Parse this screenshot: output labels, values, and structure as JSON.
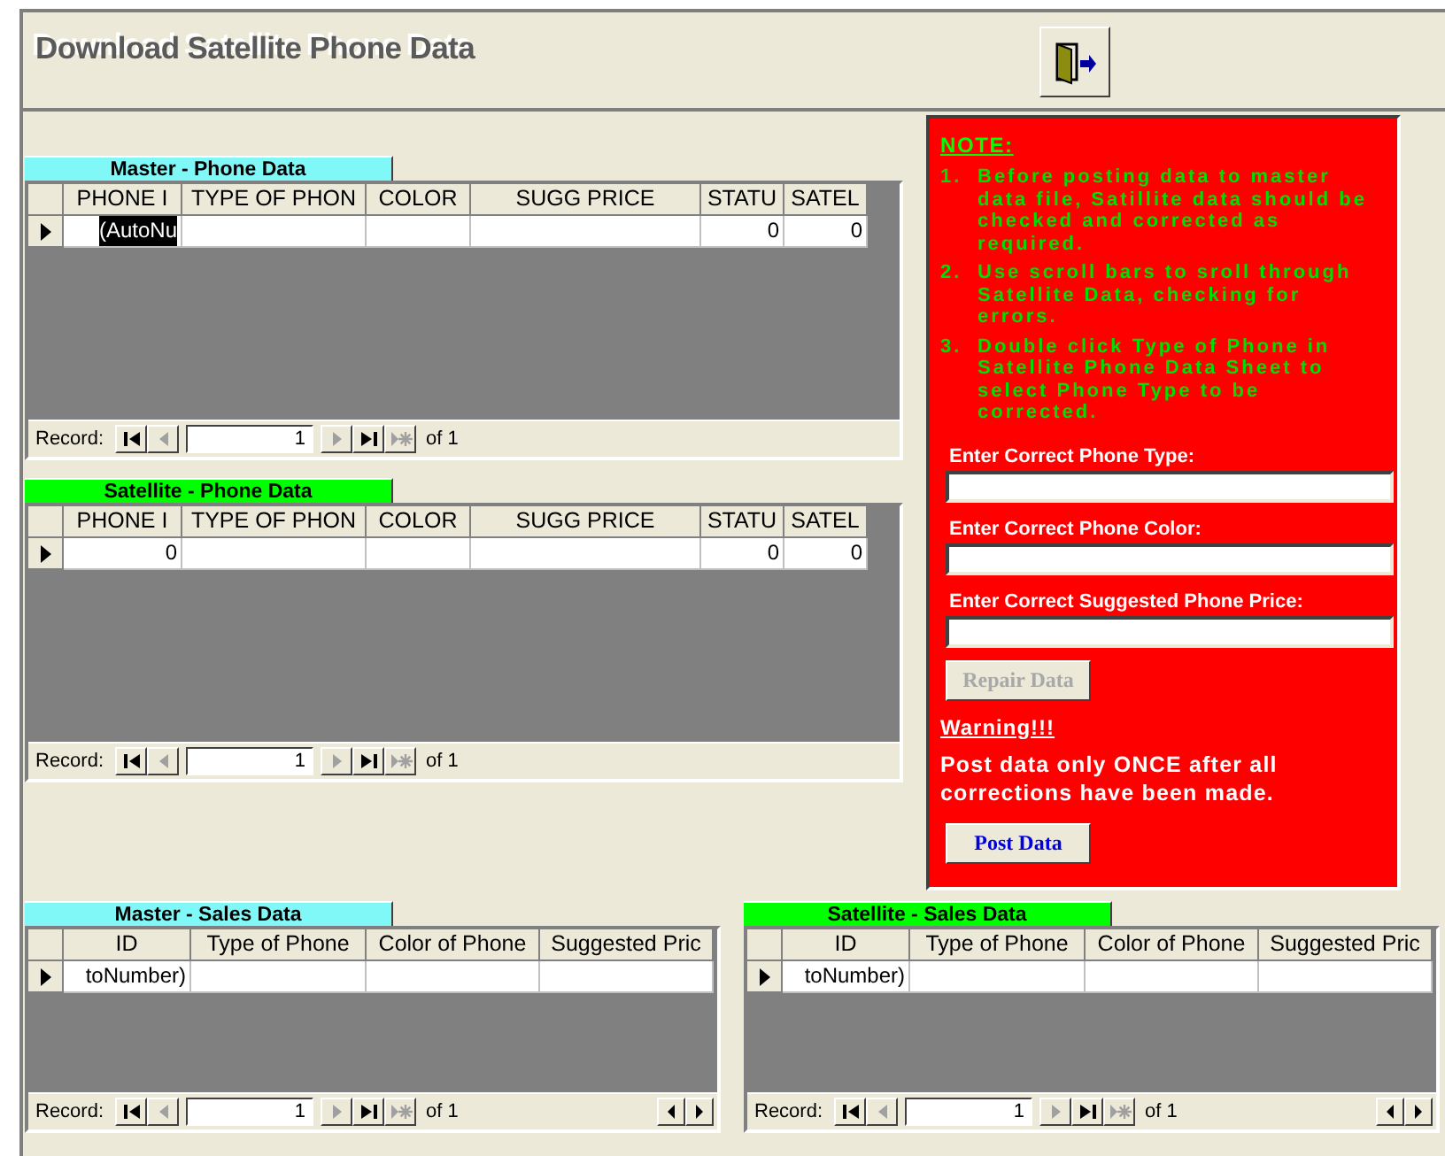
{
  "window": {
    "title": "Download Satellite Phone Data"
  },
  "phone_sheets": [
    {
      "caption": "Master - Phone  Data",
      "color": "#80f8f8",
      "kind": "phone",
      "columns": [
        "PHONE I",
        "TYPE OF PHON",
        "COLOR",
        "SUGG PRICE",
        "STATU",
        "SATEL"
      ],
      "rows": [
        {
          "current": true,
          "cells": [
            {
              "text": "(AutoNu",
              "selected": true
            },
            {
              "selected": false
            },
            {
              "selected": false
            },
            {
              "selected": false
            },
            {
              "text": "0",
              "selected": false
            },
            {
              "text": "0",
              "selected": false
            }
          ]
        }
      ],
      "navigator": {
        "label": "Record:",
        "value": "1",
        "total": "of 1",
        "buttons": [
          {
            "kind": "first",
            "disabled": false
          },
          {
            "kind": "prev",
            "disabled": true
          },
          {
            "kind": "next",
            "disabled": true
          },
          {
            "kind": "last",
            "disabled": false
          },
          {
            "kind": "new",
            "disabled": true
          }
        ]
      }
    },
    {
      "caption": "Satellite - Phone Data",
      "color": "#00ff00",
      "kind": "phone",
      "columns": [
        "PHONE I",
        "TYPE OF PHON",
        "COLOR",
        "SUGG PRICE",
        "STATU",
        "SATEL"
      ],
      "rows": [
        {
          "current": true,
          "cells": [
            {
              "text": "0",
              "selected": false
            },
            {
              "selected": false
            },
            {
              "selected": false
            },
            {
              "selected": false
            },
            {
              "text": "0",
              "selected": false
            },
            {
              "text": "0",
              "selected": false
            }
          ]
        }
      ],
      "navigator": {
        "label": "Record:",
        "value": "1",
        "total": "of 1",
        "buttons": [
          {
            "kind": "first",
            "disabled": false
          },
          {
            "kind": "prev",
            "disabled": true
          },
          {
            "kind": "next",
            "disabled": true
          },
          {
            "kind": "last",
            "disabled": false
          },
          {
            "kind": "new",
            "disabled": true
          }
        ]
      }
    }
  ],
  "note_panel": {
    "heading": "NOTE:",
    "steps": [
      {
        "number": "1.",
        "text": "Before posting data to master data file, Satillite data should be checked and corrected as required."
      },
      {
        "number": "2.",
        "text": "Use scroll bars to sroll through Satellite Data, checking for errors."
      },
      {
        "number": "3.",
        "text": "Double click Type of Phone in Satellite Phone Data Sheet to select Phone Type to be corrected."
      }
    ],
    "fields": [
      {
        "label": "Enter Correct Phone Type:"
      },
      {
        "label": "Enter Correct Phone Color:"
      },
      {
        "label": "Enter Correct Suggested  Phone Price:"
      }
    ],
    "repair_button": {
      "label": "Repair Data",
      "disabled": true
    },
    "warning": {
      "heading": "Warning!!!",
      "text": "Post data only ONCE after all corrections have been made."
    },
    "post_button": {
      "label": "Post Data",
      "disabled": false
    }
  },
  "sales_sheets": [
    {
      "caption": "Master - Sales Data",
      "color": "#80f8f8",
      "kind": "sales",
      "columns": [
        "ID",
        "Type of Phone",
        "Color of Phone",
        "Suggested Pric"
      ],
      "rows": [
        {
          "current": true,
          "cells": [
            {
              "text": "toNumber)",
              "selected": false
            },
            {
              "selected": false
            },
            {
              "selected": false
            },
            {
              "selected": false
            }
          ]
        }
      ],
      "navigator": {
        "label": "Record:",
        "value": "1",
        "total": "of 1",
        "buttons": [
          {
            "kind": "first",
            "disabled": false
          },
          {
            "kind": "prev",
            "disabled": true
          },
          {
            "kind": "next",
            "disabled": true
          },
          {
            "kind": "last",
            "disabled": false
          },
          {
            "kind": "new",
            "disabled": true
          }
        ]
      }
    },
    {
      "caption": "Satellite - Sales Data",
      "color": "#00ff00",
      "kind": "sales",
      "columns": [
        "ID",
        "Type of Phone",
        "Color of Phone",
        "Suggested Pric"
      ],
      "rows": [
        {
          "current": true,
          "cells": [
            {
              "text": "toNumber)",
              "selected": false
            },
            {
              "selected": false
            },
            {
              "selected": false
            },
            {
              "selected": false
            }
          ]
        }
      ],
      "navigator": {
        "label": "Record:",
        "value": "1",
        "total": "of 1",
        "buttons": [
          {
            "kind": "first",
            "disabled": false
          },
          {
            "kind": "prev",
            "disabled": true
          },
          {
            "kind": "next",
            "disabled": true
          },
          {
            "kind": "last",
            "disabled": false
          },
          {
            "kind": "new",
            "disabled": true
          }
        ]
      }
    }
  ]
}
